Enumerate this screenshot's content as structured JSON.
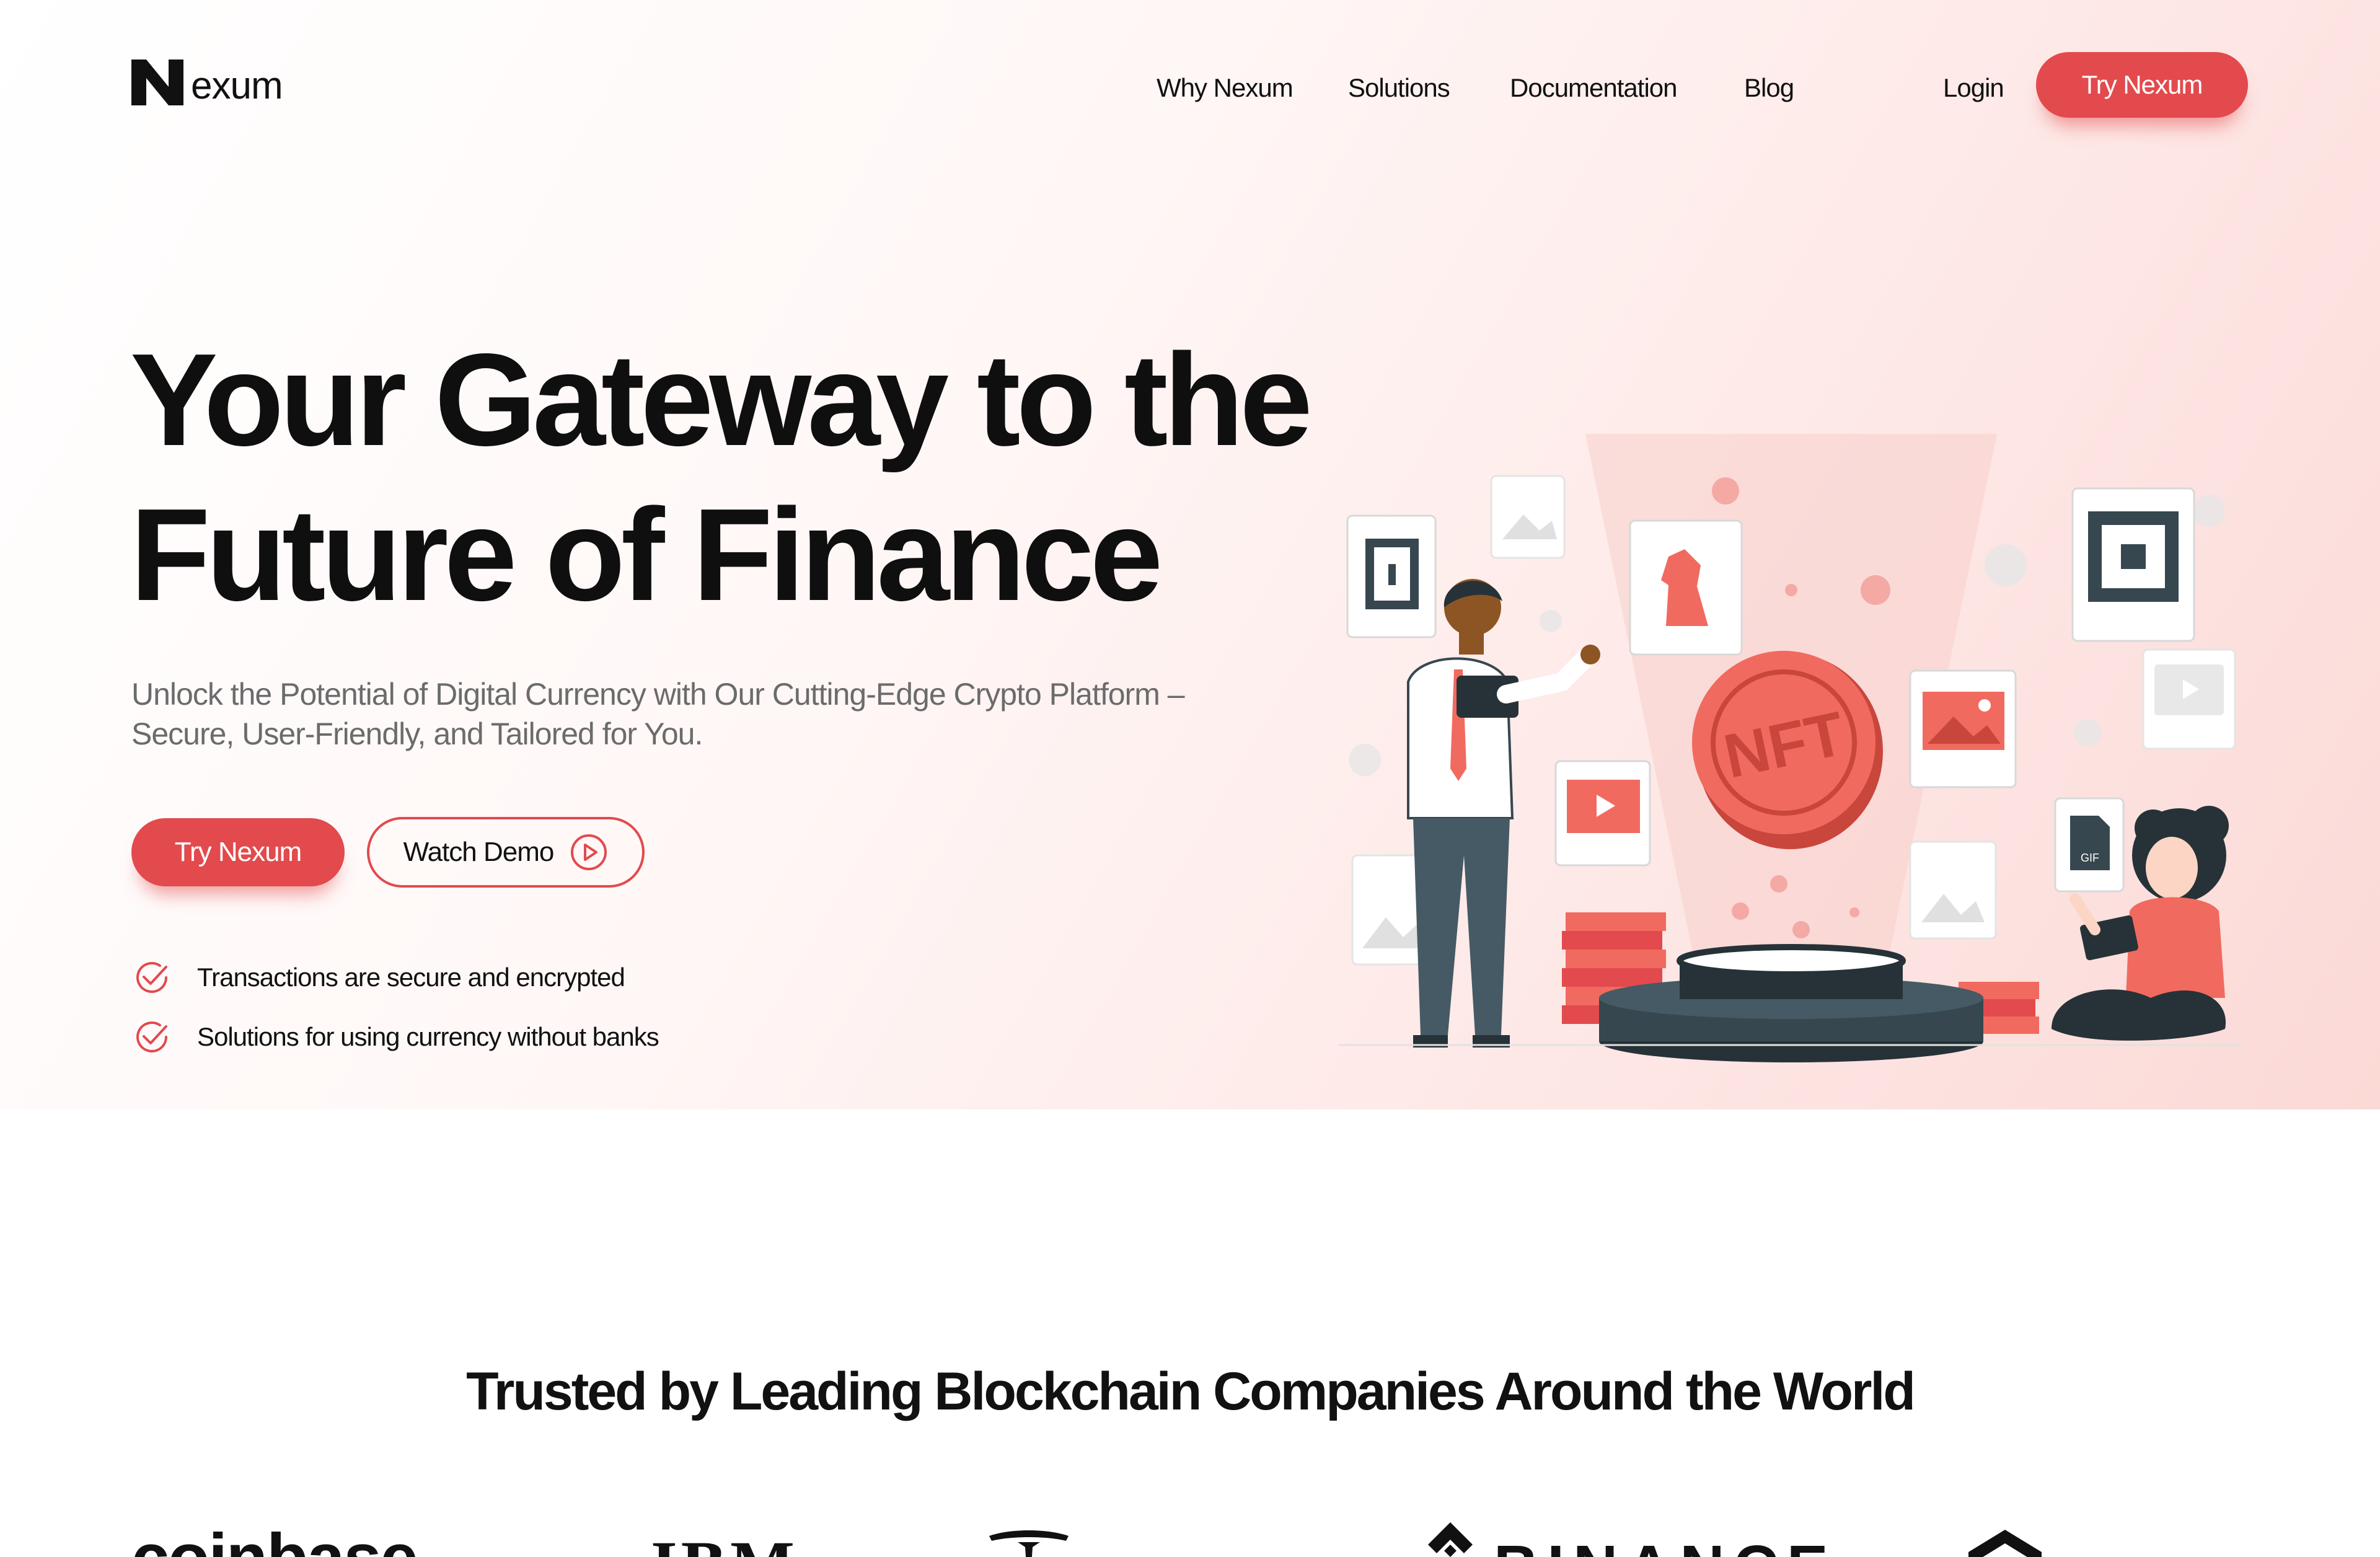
{
  "colors": {
    "accent": "#e24a4d",
    "text": "#111111",
    "muted": "#6b6b6b",
    "hero_bg_end": "#fbd9d6"
  },
  "nav": {
    "logo_text": "exum",
    "links": [
      "Why Nexum",
      "Solutions",
      "Documentation",
      "Blog"
    ],
    "login": "Login",
    "cta": "Try Nexum"
  },
  "hero": {
    "headline_line1": "Your Gateway to the",
    "headline_line2": "Future of Finance",
    "subtext": "Unlock the Potential of Digital Currency with Our Cutting-Edge Crypto Platform – Secure, User-Friendly, and Tailored for You.",
    "primary_button": "Try Nexum",
    "secondary_button": "Watch Demo",
    "features": [
      "Transactions are secure and encrypted",
      "Solutions for using currency without  banks"
    ],
    "illustration": {
      "coin_text": "NFT",
      "file_label": "GIF"
    }
  },
  "trusted": {
    "title": "Trusted by Leading Blockchain Companies Around the World",
    "brands": [
      "coinbase",
      "IBM",
      "tesla-logo",
      "BINANCE",
      "chainlink-logo"
    ]
  }
}
